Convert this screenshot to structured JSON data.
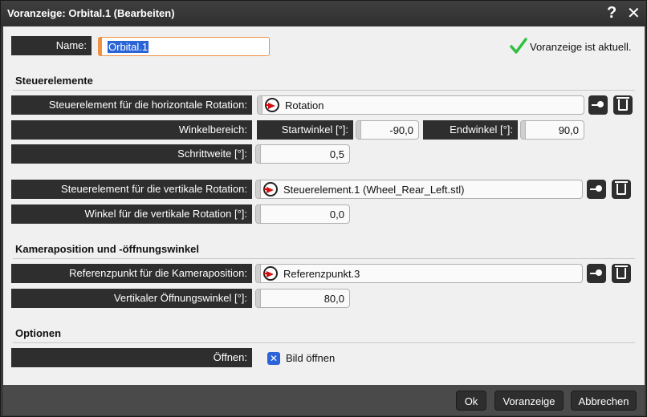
{
  "window": {
    "title": "Voranzeige: Orbital.1 (Bearbeiten)",
    "help_glyph": "?",
    "close_glyph": "✕"
  },
  "name": {
    "label": "Name:",
    "value": "Orbital.1"
  },
  "status": {
    "text": "Voranzeige ist aktuell.",
    "color": "#2fc040"
  },
  "sections": {
    "controls": "Steuerelemente",
    "camera": "Kameraposition und -öffnungswinkel",
    "options": "Optionen"
  },
  "horizontal": {
    "label": "Steuerelement für die horizontale Rotation:",
    "value": "Rotation",
    "range_label": "Winkelbereich:",
    "start_label": "Startwinkel [°]:",
    "start_value": "-90,0",
    "end_label": "Endwinkel [°]:",
    "end_value": "90,0",
    "step_label": "Schrittweite [°]:",
    "step_value": "0,5"
  },
  "vertical": {
    "label": "Steuerelement für die vertikale Rotation:",
    "value": "Steuerelement.1 (Wheel_Rear_Left.stl)",
    "angle_label": "Winkel für die vertikale Rotation [°]:",
    "angle_value": "0,0"
  },
  "camera": {
    "ref_label": "Referenzpunkt für die Kameraposition:",
    "ref_value": "Referenzpunkt.3",
    "fov_label": "Vertikaler Öffnungswinkel [°]:",
    "fov_value": "80,0"
  },
  "options": {
    "open_label": "Öffnen:",
    "open_checkbox_label": "Bild öffnen",
    "open_checked": true
  },
  "footer": {
    "ok": "Ok",
    "preview": "Voranzeige",
    "cancel": "Abbrechen"
  },
  "icons": {
    "reference": "reference-arrow-icon",
    "pick": "pick-icon",
    "trash": "trash-icon",
    "check": "check-icon"
  }
}
